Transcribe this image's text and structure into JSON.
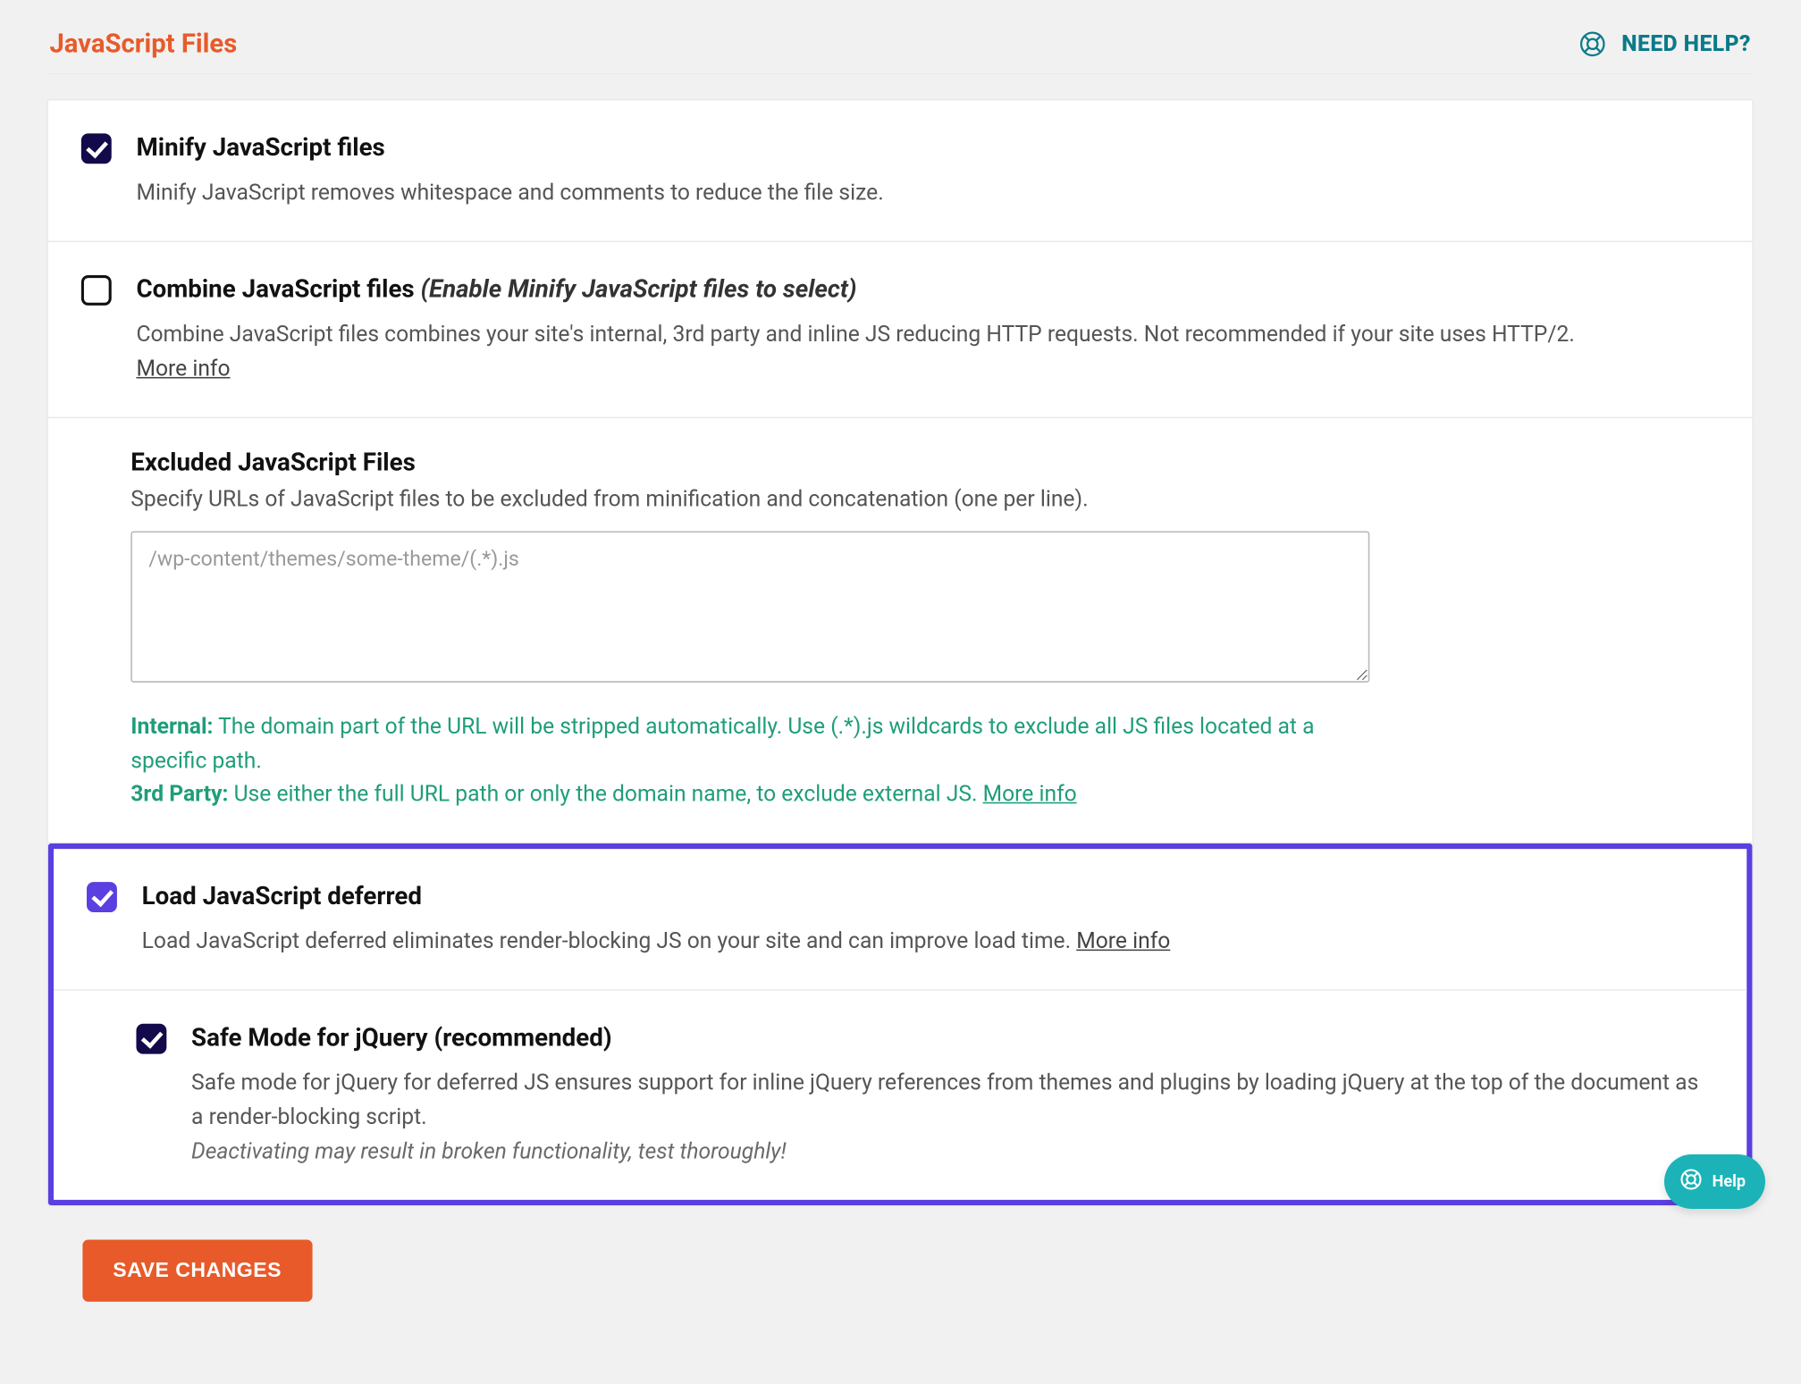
{
  "header": {
    "title": "JavaScript Files",
    "need_help": "NEED HELP?"
  },
  "options": {
    "minify": {
      "title": "Minify JavaScript files",
      "desc": "Minify JavaScript removes whitespace and comments to reduce the file size.",
      "checked": true
    },
    "combine": {
      "title": "Combine JavaScript files",
      "hint": "(Enable Minify JavaScript files to select)",
      "desc": "Combine JavaScript files combines your site's internal, 3rd party and inline JS reducing HTTP requests. Not recommended if your site uses HTTP/2.",
      "more": "More info",
      "checked": false
    },
    "excluded": {
      "title": "Excluded JavaScript Files",
      "desc": "Specify URLs of JavaScript files to be excluded from minification and concatenation (one per line).",
      "placeholder": "/wp-content/themes/some-theme/(.*).js",
      "value": "",
      "hint_internal_label": "Internal:",
      "hint_internal_text": " The domain part of the URL will be stripped automatically. Use (.*).js wildcards to exclude all JS files located at a specific path.",
      "hint_third_label": "3rd Party:",
      "hint_third_text": " Use either the full URL path or only the domain name, to exclude external JS. ",
      "hint_third_more": "More info"
    },
    "defer": {
      "title": "Load JavaScript deferred",
      "desc": "Load JavaScript deferred eliminates render-blocking JS on your site and can improve load time. ",
      "more": "More info",
      "checked": true
    },
    "safe_mode": {
      "title": "Safe Mode for jQuery (recommended)",
      "desc": "Safe mode for jQuery for deferred JS ensures support for inline jQuery references from themes and plugins by loading jQuery at the top of the document as a render-blocking script.",
      "warn": "Deactivating may result in broken functionality, test thoroughly!",
      "checked": true
    }
  },
  "buttons": {
    "save": "SAVE CHANGES"
  },
  "help_widget": {
    "label": "Help"
  }
}
